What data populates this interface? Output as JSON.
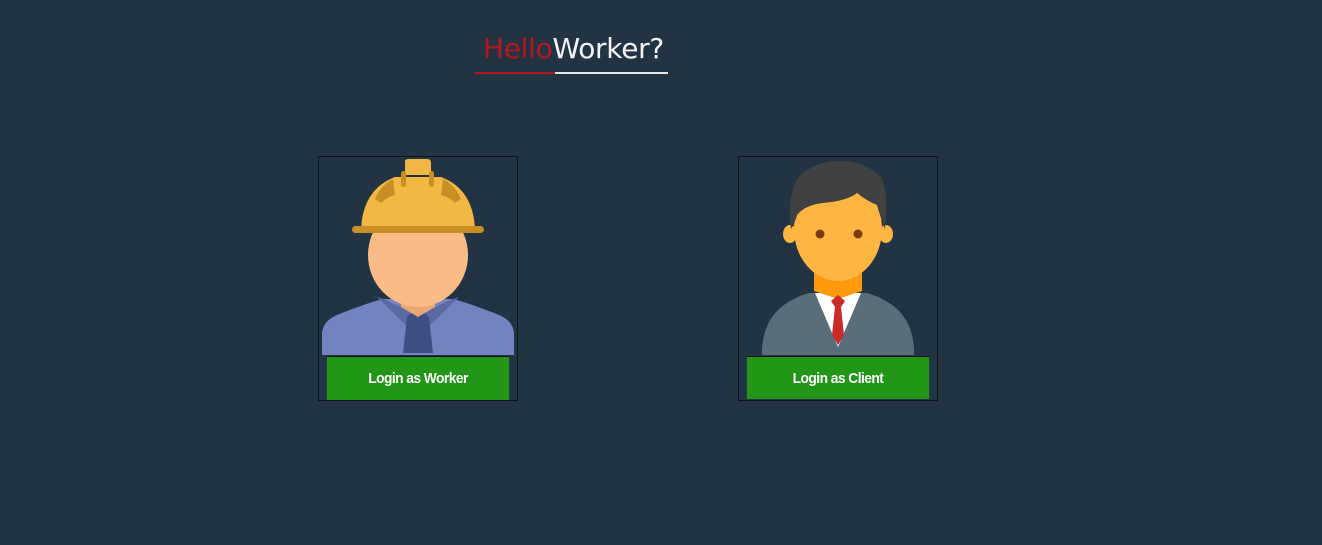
{
  "header": {
    "title_hello": "Hello",
    "title_worker": "Worker?"
  },
  "cards": {
    "worker": {
      "avatar_icon": "construction-worker-icon",
      "button_label": "Login as Worker"
    },
    "client": {
      "avatar_icon": "businessman-icon",
      "button_label": "Login as Client"
    }
  },
  "colors": {
    "background": "#223344",
    "accent_red": "#b3161c",
    "button_green": "#229617"
  }
}
